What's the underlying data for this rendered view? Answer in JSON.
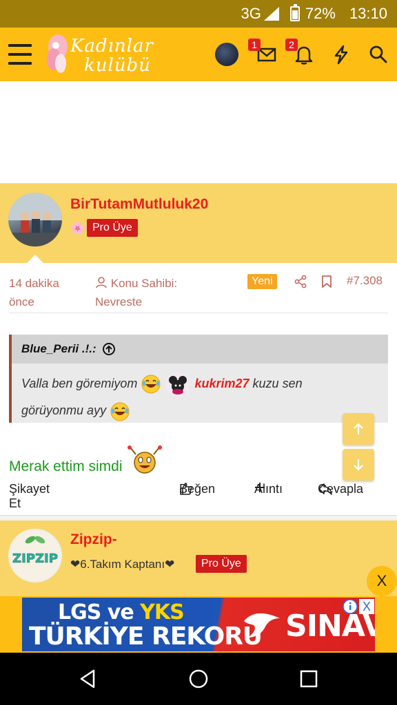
{
  "status_bar": {
    "network": "3G",
    "network_sup": "3G",
    "battery_percent": "72%",
    "battery_level": 0.72,
    "time": "13:10"
  },
  "header": {
    "logo_line1": "Kadınlar",
    "logo_line2": "kulübü",
    "messages_badge": "1",
    "notifications_badge": "2",
    "accent_color": "#fdbd13"
  },
  "post1": {
    "username": "BirTutamMutluluk20",
    "user_title": "🌸🌸",
    "pro_badge": "Pro Üye",
    "time_ago": "14 dakika önce",
    "owner_label": "Konu Sahibi:",
    "owner_name": "Nevreste",
    "new_badge": "Yeni",
    "post_number": "#7.308",
    "quote_author": "Blue_Perii .!.:",
    "quote_text_1": "Valla ben göremiyom",
    "quote_mention": "kukrim27",
    "quote_text_2": "kuzu sen",
    "quote_text_3": "görüyonmu ayy",
    "body": "Merak ettim simdi",
    "report": "Şikayet Et",
    "like": "Beğen",
    "quote_action": "Alıntı",
    "reply": "Cevapla"
  },
  "post2": {
    "username": "Zipzip-",
    "user_title": "❤6.Takım Kaptanı❤",
    "pro_badge": "Pro Üye",
    "avatar_text": "ZIPZIP"
  },
  "close_ad": "X",
  "banner": {
    "line1_a": "LGS ve ",
    "line1_b": "YKS",
    "line2": "TÜRKİYE REKORU",
    "brand": "SINAV",
    "close": "X"
  },
  "colors": {
    "username": "#e8201c",
    "post_text": "#1a9a1a",
    "meta": "#c06a60",
    "header_bg": "#f9d567"
  }
}
